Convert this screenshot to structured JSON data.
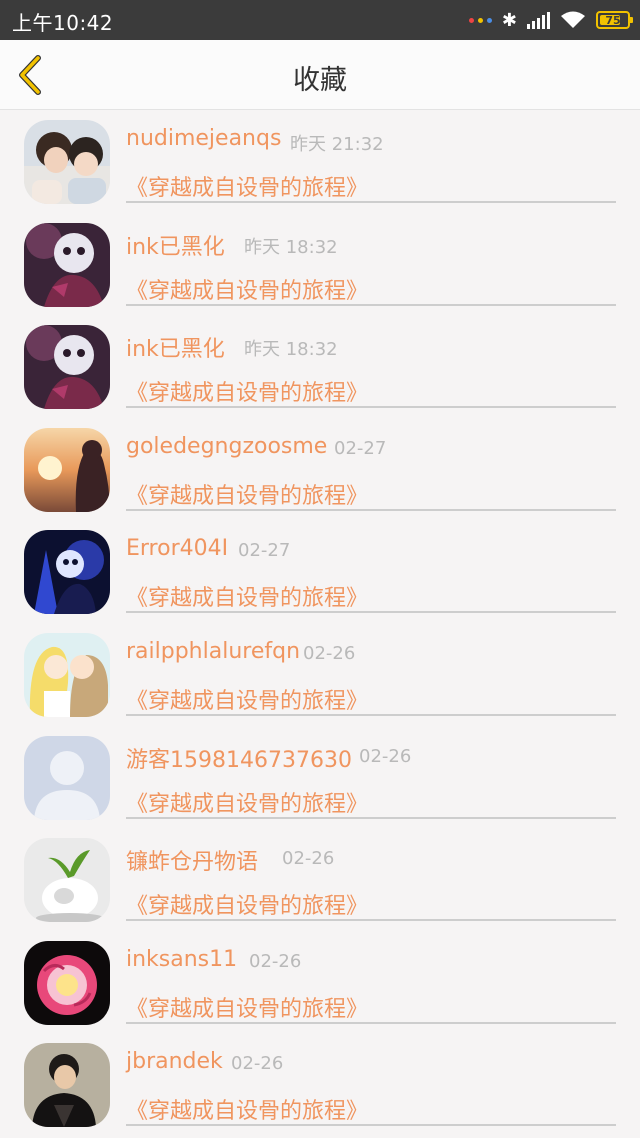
{
  "status_bar": {
    "time": "上午10:42",
    "battery": "75",
    "icons": [
      "dots-icon",
      "bluetooth-icon",
      "signal-icon",
      "wifi-icon",
      "battery-icon"
    ]
  },
  "header": {
    "title": "收藏",
    "back_icon": "chevron-left-icon"
  },
  "colors": {
    "accent": "#f0955f",
    "back_icon": "#f2c200",
    "date": "#b9b9b9"
  },
  "favorites": [
    {
      "user": "nudimejeanqs",
      "time": "昨天 21:32",
      "book": "《穿越成自设骨的旅程》"
    },
    {
      "user": "ink已黑化",
      "time": "昨天 18:32",
      "book": "《穿越成自设骨的旅程》"
    },
    {
      "user": "ink已黑化",
      "time": "昨天 18:32",
      "book": "《穿越成自设骨的旅程》"
    },
    {
      "user": "goledegngzoosme",
      "time": "02-27",
      "book": "《穿越成自设骨的旅程》"
    },
    {
      "user": "Error404I",
      "time": "02-27",
      "book": "《穿越成自设骨的旅程》"
    },
    {
      "user": "railpphlalurefqn",
      "time": "02-26",
      "book": "《穿越成自设骨的旅程》"
    },
    {
      "user": "游客1598146737630",
      "time": "02-26",
      "book": "《穿越成自设骨的旅程》"
    },
    {
      "user": "镰蚱仓丹物语",
      "time": "02-26",
      "book": "《穿越成自设骨的旅程》"
    },
    {
      "user": "inksans11",
      "time": "02-26",
      "book": "《穿越成自设骨的旅程》"
    },
    {
      "user": "jbrandek",
      "time": "02-26",
      "book": "《穿越成自设骨的旅程》"
    }
  ]
}
